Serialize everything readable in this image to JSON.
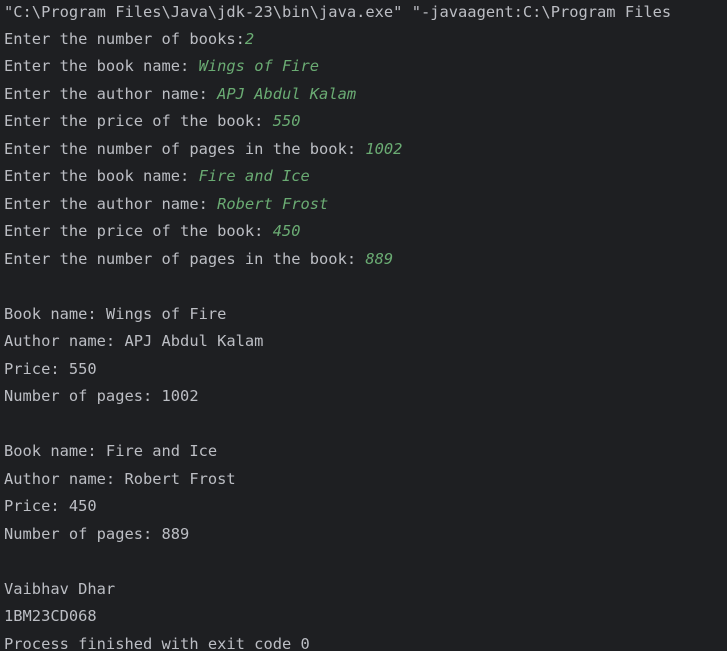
{
  "console": {
    "command": "\"C:\\Program Files\\Java\\jdk-23\\bin\\java.exe\" \"-javaagent:C:\\Program Files",
    "prompts": [
      {
        "text": "Enter the number of books:",
        "input": "2"
      },
      {
        "text": "Enter the book name: ",
        "input": "Wings of Fire"
      },
      {
        "text": "Enter the author name: ",
        "input": "APJ Abdul Kalam"
      },
      {
        "text": "Enter the price of the book: ",
        "input": "550"
      },
      {
        "text": "Enter the number of pages in the book: ",
        "input": "1002"
      },
      {
        "text": "Enter the book name: ",
        "input": "Fire and Ice"
      },
      {
        "text": "Enter the author name: ",
        "input": "Robert Frost"
      },
      {
        "text": "Enter the price of the book: ",
        "input": "450"
      },
      {
        "text": "Enter the number of pages in the book: ",
        "input": "889"
      }
    ],
    "books": [
      {
        "name": "Book name: Wings of Fire",
        "author": "Author name: APJ Abdul Kalam",
        "price": "Price: 550",
        "pages": "Number of pages: 1002"
      },
      {
        "name": "Book name: Fire and Ice",
        "author": "Author name: Robert Frost",
        "price": "Price: 450",
        "pages": "Number of pages: 889"
      }
    ],
    "student_name": "Vaibhav Dhar",
    "student_id": "1BM23CD068",
    "exit_message": "Process finished with exit code 0"
  },
  "colors": {
    "background": "#1e1f22",
    "output_text": "#bcbec4",
    "user_input": "#6aab73"
  }
}
